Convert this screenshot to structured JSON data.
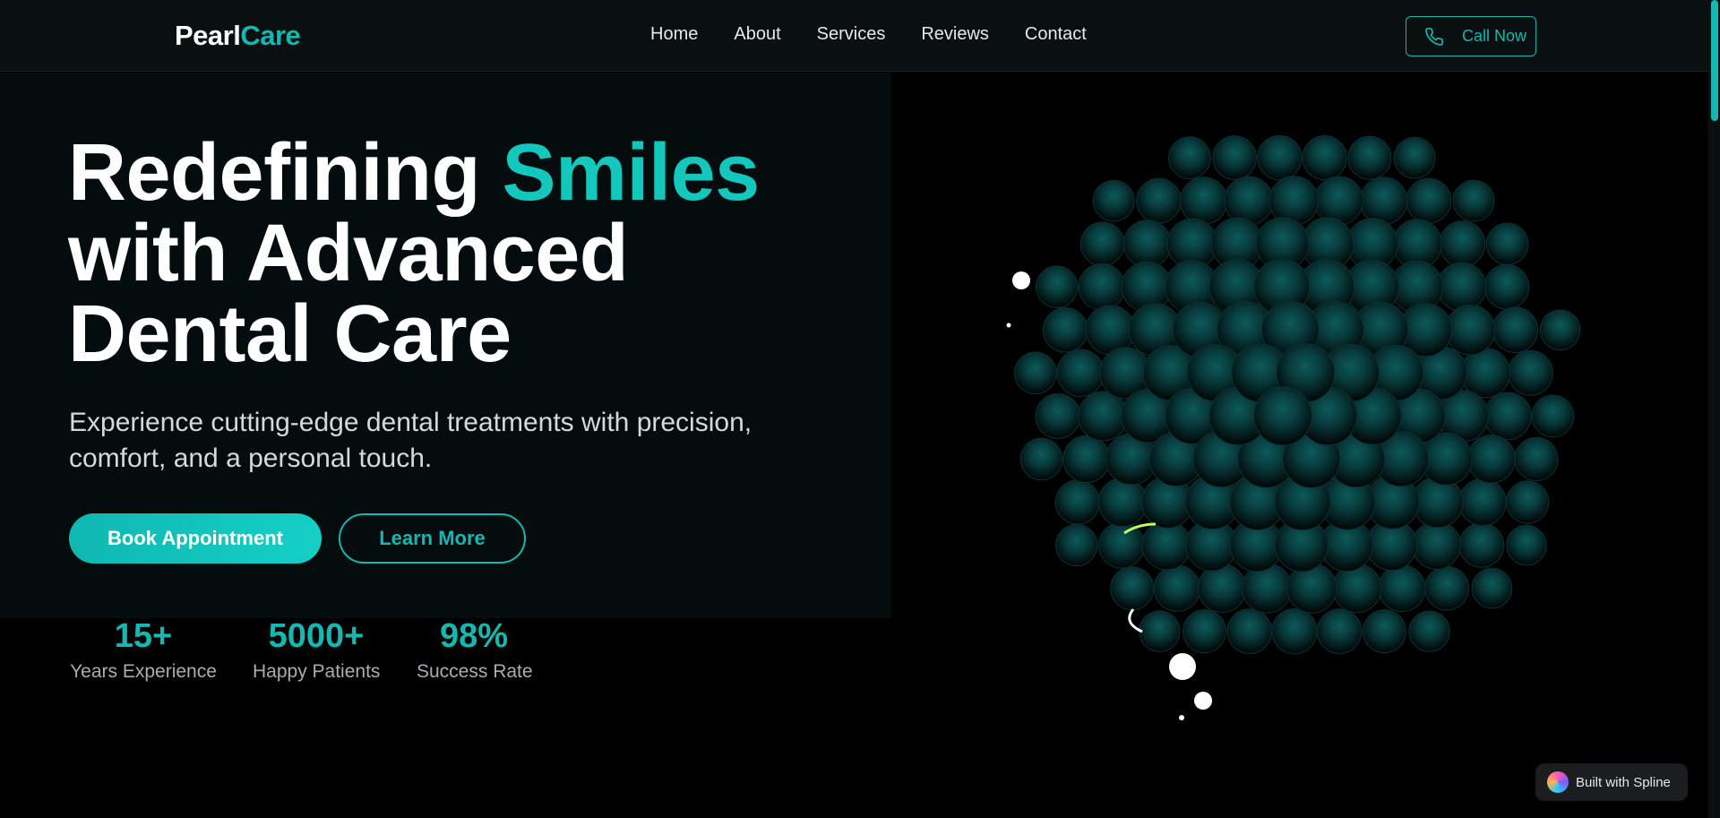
{
  "header": {
    "logo_part1": "Pearl",
    "logo_part2": "Care",
    "nav": [
      "Home",
      "About",
      "Services",
      "Reviews",
      "Contact"
    ],
    "call_button": "Call Now",
    "call_icon": "phone-icon"
  },
  "hero": {
    "headline_part1": "Redefining ",
    "headline_accent": "Smiles",
    "headline_line2": "with Advanced",
    "headline_line3": "Dental Care",
    "subtext": "Experience cutting-edge dental treatments with precision, comfort, and a personal touch.",
    "primary_button": "Book Appointment",
    "secondary_button": "Learn More"
  },
  "stats": [
    {
      "value": "15+",
      "label": "Years Experience"
    },
    {
      "value": "5000+",
      "label": "Happy Patients"
    },
    {
      "value": "98%",
      "label": "Success Rate"
    }
  ],
  "badge": {
    "text": "Built with Spline"
  },
  "colors": {
    "accent": "#14b8b0",
    "background": "#000000",
    "panel": "#050c0d"
  }
}
